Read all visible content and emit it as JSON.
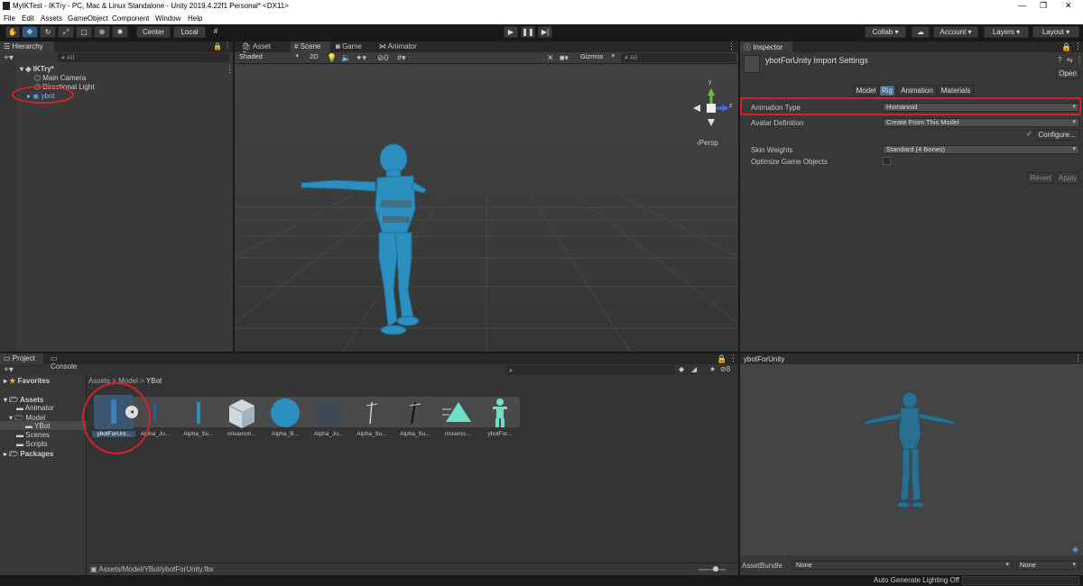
{
  "titlebar": {
    "title": "MyIKTest - IKTry - PC, Mac & Linux Standalone - Unity 2019.4.22f1 Personal* <DX11>"
  },
  "menu": [
    "File",
    "Edit",
    "Assets",
    "GameObject",
    "Component",
    "Window",
    "Help"
  ],
  "toolbar": {
    "center": "Center",
    "local": "Local",
    "collab": "Collab",
    "account": "Account",
    "layers": "Layers",
    "layout": "Layout"
  },
  "hierarchy": {
    "tab": "Hierarchy",
    "search_placeholder": "All",
    "scene": "IKTry*",
    "items": [
      "Main Camera",
      "Directional Light",
      "ybot"
    ]
  },
  "scene_view": {
    "tabs": [
      "Asset Store",
      "Scene",
      "Game",
      "Animator"
    ],
    "shading": "Shaded",
    "mode_2d": "2D",
    "hidden_count": "0",
    "gizmos": "Gizmos",
    "search_placeholder": "All",
    "persp": "Persp",
    "axis_y": "y",
    "axis_z": "z"
  },
  "inspector": {
    "tab": "Inspector",
    "title": "ybotForUnity Import Settings",
    "open": "Open",
    "tabs": [
      "Model",
      "Rig",
      "Animation",
      "Materials"
    ],
    "animation_type_label": "Animation Type",
    "animation_type_value": "Humanoid",
    "avatar_def_label": "Avatar Definition",
    "avatar_def_value": "Create From This Model",
    "configure": "Configure...",
    "skin_weights_label": "Skin Weights",
    "skin_weights_value": "Standard (4 Bones)",
    "optimize_label": "Optimize Game Objects",
    "revert": "Revert",
    "apply": "Apply"
  },
  "project": {
    "tabs": [
      "Project",
      "Console"
    ],
    "favorites": "Favorites",
    "assets": "Assets",
    "tree": [
      "Animator",
      "Model",
      "YBot",
      "Scenes",
      "Scripts"
    ],
    "packages": "Packages",
    "breadcrumb": [
      "Assets",
      "Model",
      "YBot"
    ],
    "hidden_count": "8",
    "assets_list": [
      "ybotForUni...",
      "Alpha_Jo...",
      "Alpha_Su...",
      "mixamori...",
      "Alpha_B...",
      "Alpha_Jo...",
      "Alpha_Su...",
      "Alpha_Su...",
      "mixamo....",
      "ybotFor..."
    ],
    "footer_path": "Assets/Model/YBot/ybotForUnity.fbx"
  },
  "preview": {
    "title": "ybotForUnity",
    "assetbundle_label": "AssetBundle",
    "bundle_value": "None",
    "variant_value": "None"
  },
  "status": {
    "lighting": "Auto Generate Lighting Off"
  },
  "colors": {
    "accent": "#2d5a87",
    "highlight": "#d3212d",
    "robot": "#2b8fbf"
  }
}
